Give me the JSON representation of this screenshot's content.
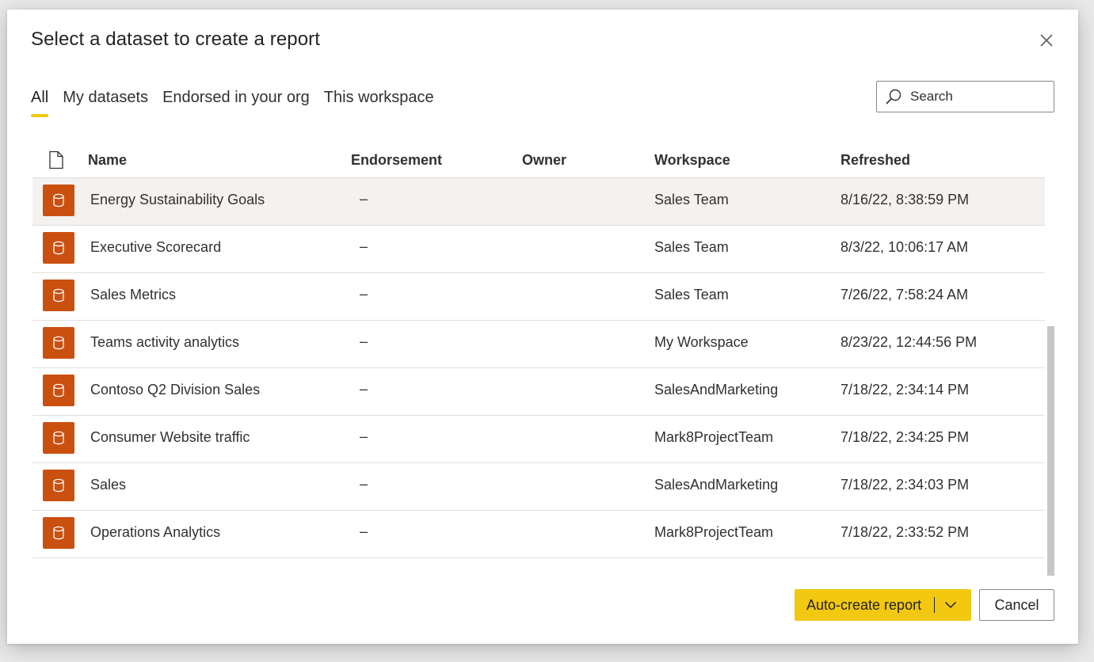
{
  "dialog": {
    "title": "Select a dataset to create a report",
    "close_icon": "close-icon"
  },
  "tabs": [
    {
      "label": "All",
      "active": true
    },
    {
      "label": "My datasets",
      "active": false
    },
    {
      "label": "Endorsed in your org",
      "active": false
    },
    {
      "label": "This workspace",
      "active": false
    }
  ],
  "search": {
    "placeholder": "Search",
    "icon": "search-icon"
  },
  "table": {
    "file_icon": "file-icon",
    "headers": {
      "name": "Name",
      "endorsement": "Endorsement",
      "owner": "Owner",
      "workspace": "Workspace",
      "refreshed": "Refreshed"
    },
    "rows": [
      {
        "name": "Energy Sustainability Goals",
        "endorsement": "–",
        "owner": "",
        "workspace": "Sales Team",
        "refreshed": "8/16/22, 8:38:59 PM",
        "highlighted": true
      },
      {
        "name": "Executive Scorecard",
        "endorsement": "–",
        "owner": "",
        "workspace": "Sales Team",
        "refreshed": "8/3/22, 10:06:17 AM"
      },
      {
        "name": "Sales Metrics",
        "endorsement": "–",
        "owner": "",
        "workspace": "Sales Team",
        "refreshed": "7/26/22, 7:58:24 AM"
      },
      {
        "name": "Teams activity analytics",
        "endorsement": "–",
        "owner": "",
        "workspace": "My Workspace",
        "refreshed": "8/23/22, 12:44:56 PM"
      },
      {
        "name": "Contoso Q2 Division Sales",
        "endorsement": "–",
        "owner": "",
        "workspace": "SalesAndMarketing",
        "refreshed": "7/18/22, 2:34:14 PM"
      },
      {
        "name": "Consumer Website traffic",
        "endorsement": "–",
        "owner": "",
        "workspace": "Mark8ProjectTeam",
        "refreshed": "7/18/22, 2:34:25 PM"
      },
      {
        "name": "Sales",
        "endorsement": "–",
        "owner": "",
        "workspace": "SalesAndMarketing",
        "refreshed": "7/18/22, 2:34:03 PM"
      },
      {
        "name": "Operations Analytics",
        "endorsement": "–",
        "owner": "",
        "workspace": "Mark8ProjectTeam",
        "refreshed": "7/18/22, 2:33:52 PM"
      }
    ]
  },
  "footer": {
    "auto_create_label": "Auto-create report",
    "cancel_label": "Cancel"
  },
  "colors": {
    "accent": "#f2c811",
    "dataset_icon": "#ca5010",
    "row_highlight": "#f3f2f1"
  }
}
